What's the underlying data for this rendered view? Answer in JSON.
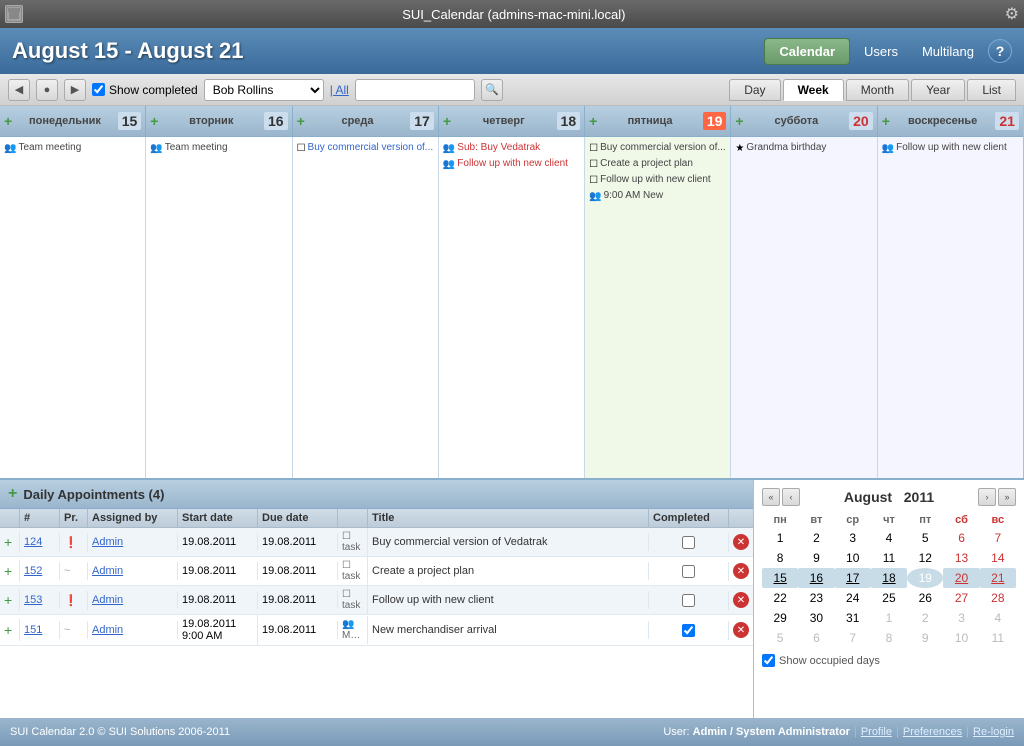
{
  "titlebar": {
    "title": "SUI_Calendar (admins-mac-mini.local)"
  },
  "header": {
    "date_range": "August 15 - August 21",
    "nav_buttons": [
      {
        "label": "Calendar",
        "active": true
      },
      {
        "label": "Users"
      },
      {
        "label": "Multilang"
      }
    ],
    "help_label": "?"
  },
  "toolbar": {
    "show_completed_label": "Show completed",
    "user": "Bob Rollins",
    "all_link": "| All",
    "search_placeholder": "",
    "tabs": [
      "Day",
      "Week",
      "Month",
      "Year",
      "List"
    ],
    "active_tab": "Week"
  },
  "calendar": {
    "days": [
      {
        "name": "понедельник",
        "num": "15",
        "is_weekend": false,
        "is_today": false,
        "events": [
          {
            "icon": "👥",
            "text": "Team meeting",
            "color": "gray"
          }
        ]
      },
      {
        "name": "вторник",
        "num": "16",
        "is_weekend": false,
        "is_today": false,
        "events": [
          {
            "icon": "👥",
            "text": "Team meeting",
            "color": "gray"
          }
        ]
      },
      {
        "name": "среда",
        "num": "17",
        "is_weekend": false,
        "is_today": false,
        "events": [
          {
            "icon": "☐",
            "text": "Buy commercial version of...",
            "color": "blue"
          }
        ]
      },
      {
        "name": "четверг",
        "num": "18",
        "is_weekend": false,
        "is_today": false,
        "events": [
          {
            "icon": "👥",
            "text": "Sub: Buy Vedatrak",
            "color": "red"
          },
          {
            "icon": "👥",
            "text": "Follow up with new client",
            "color": "red"
          }
        ]
      },
      {
        "name": "пятница",
        "num": "19",
        "is_weekend": false,
        "is_today": true,
        "events": [
          {
            "icon": "☐",
            "text": "Buy commercial version of...",
            "color": "gray"
          },
          {
            "icon": "☐",
            "text": "Create a project plan",
            "color": "gray"
          },
          {
            "icon": "☐",
            "text": "Follow up with new client",
            "color": "gray"
          },
          {
            "icon": "👥",
            "text": "9:00 AM New",
            "color": "gray"
          }
        ]
      },
      {
        "name": "суббота",
        "num": "20",
        "is_weekend": true,
        "is_today": false,
        "events": [
          {
            "icon": "★",
            "text": "Grandma birthday",
            "color": "gray"
          }
        ]
      },
      {
        "name": "воскресенье",
        "num": "21",
        "is_weekend": true,
        "is_today": false,
        "events": [
          {
            "icon": "👥",
            "text": "Follow up with new client",
            "color": "gray"
          }
        ]
      }
    ]
  },
  "appointments": {
    "title": "Daily Appointments",
    "count": "4",
    "columns": [
      "",
      "#",
      "Pr.",
      "Assigned by",
      "Start date",
      "Due date",
      "",
      "Title",
      "Completed",
      ""
    ],
    "rows": [
      {
        "id": "124",
        "priority": "!",
        "assigned_by": "Admin",
        "start_date": "19.08.2011",
        "due_date": "19.08.2011",
        "type_icon": "task",
        "title": "Buy commercial version of Vedatrak",
        "completed": false
      },
      {
        "id": "152",
        "priority": "~",
        "assigned_by": "Admin",
        "start_date": "19.08.2011",
        "due_date": "19.08.2011",
        "type_icon": "task",
        "title": "Create a project plan",
        "completed": false
      },
      {
        "id": "153",
        "priority": "!",
        "assigned_by": "Admin",
        "start_date": "19.08.2011",
        "due_date": "19.08.2011",
        "type_icon": "task",
        "title": "Follow up with new client",
        "completed": false
      },
      {
        "id": "151",
        "priority": "~",
        "assigned_by": "Admin",
        "start_date": "19.08.2011",
        "start_time": "9:00 AM",
        "due_date": "19.08.2011",
        "type_icon": "meeting",
        "title": "New merchandiser arrival",
        "completed": true
      }
    ]
  },
  "mini_calendar": {
    "month": "August",
    "year": "2011",
    "weekdays": [
      "пн",
      "вт",
      "ср",
      "чт",
      "пт",
      "сб",
      "вс"
    ],
    "weeks": [
      [
        {
          "day": "1",
          "other": false,
          "weekend": false
        },
        {
          "day": "2",
          "other": false,
          "weekend": false
        },
        {
          "day": "3",
          "other": false,
          "weekend": false
        },
        {
          "day": "4",
          "other": false,
          "weekend": false
        },
        {
          "day": "5",
          "other": false,
          "weekend": false
        },
        {
          "day": "6",
          "other": false,
          "weekend": true
        },
        {
          "day": "7",
          "other": false,
          "weekend": true
        }
      ],
      [
        {
          "day": "8",
          "other": false,
          "weekend": false
        },
        {
          "day": "9",
          "other": false,
          "weekend": false
        },
        {
          "day": "10",
          "other": false,
          "weekend": false
        },
        {
          "day": "11",
          "other": false,
          "weekend": false
        },
        {
          "day": "12",
          "other": false,
          "weekend": false
        },
        {
          "day": "13",
          "other": false,
          "weekend": true
        },
        {
          "day": "14",
          "other": false,
          "weekend": true
        }
      ],
      [
        {
          "day": "15",
          "other": false,
          "weekend": false,
          "selected": true
        },
        {
          "day": "16",
          "other": false,
          "weekend": false,
          "selected": true
        },
        {
          "day": "17",
          "other": false,
          "weekend": false,
          "selected": true
        },
        {
          "day": "18",
          "other": false,
          "weekend": false,
          "selected": true
        },
        {
          "day": "19",
          "other": false,
          "weekend": false,
          "selected": true,
          "today": true
        },
        {
          "day": "20",
          "other": false,
          "weekend": true,
          "selected": true
        },
        {
          "day": "21",
          "other": false,
          "weekend": true,
          "selected": true
        }
      ],
      [
        {
          "day": "22",
          "other": false,
          "weekend": false
        },
        {
          "day": "23",
          "other": false,
          "weekend": false
        },
        {
          "day": "24",
          "other": false,
          "weekend": false
        },
        {
          "day": "25",
          "other": false,
          "weekend": false
        },
        {
          "day": "26",
          "other": false,
          "weekend": false
        },
        {
          "day": "27",
          "other": false,
          "weekend": true
        },
        {
          "day": "28",
          "other": false,
          "weekend": true
        }
      ],
      [
        {
          "day": "29",
          "other": false,
          "weekend": false
        },
        {
          "day": "30",
          "other": false,
          "weekend": false
        },
        {
          "day": "31",
          "other": false,
          "weekend": false
        },
        {
          "day": "1",
          "other": true,
          "weekend": false
        },
        {
          "day": "2",
          "other": true,
          "weekend": false
        },
        {
          "day": "3",
          "other": true,
          "weekend": true
        },
        {
          "day": "4",
          "other": true,
          "weekend": true
        }
      ],
      [
        {
          "day": "5",
          "other": true,
          "weekend": false
        },
        {
          "day": "6",
          "other": true,
          "weekend": false
        },
        {
          "day": "7",
          "other": true,
          "weekend": false
        },
        {
          "day": "8",
          "other": true,
          "weekend": false
        },
        {
          "day": "9",
          "other": true,
          "weekend": false
        },
        {
          "day": "10",
          "other": true,
          "weekend": true
        },
        {
          "day": "11",
          "other": true,
          "weekend": true
        }
      ]
    ],
    "show_occupied_days": true,
    "occupied_days_label": "Show occupied days"
  },
  "statusbar": {
    "copyright": "SUI Calendar 2.0 © SUI Solutions 2006-2011",
    "user_label": "User:",
    "user_name": "Admin / System Administrator",
    "links": [
      "Profile",
      "Preferences",
      "Re-login"
    ]
  }
}
